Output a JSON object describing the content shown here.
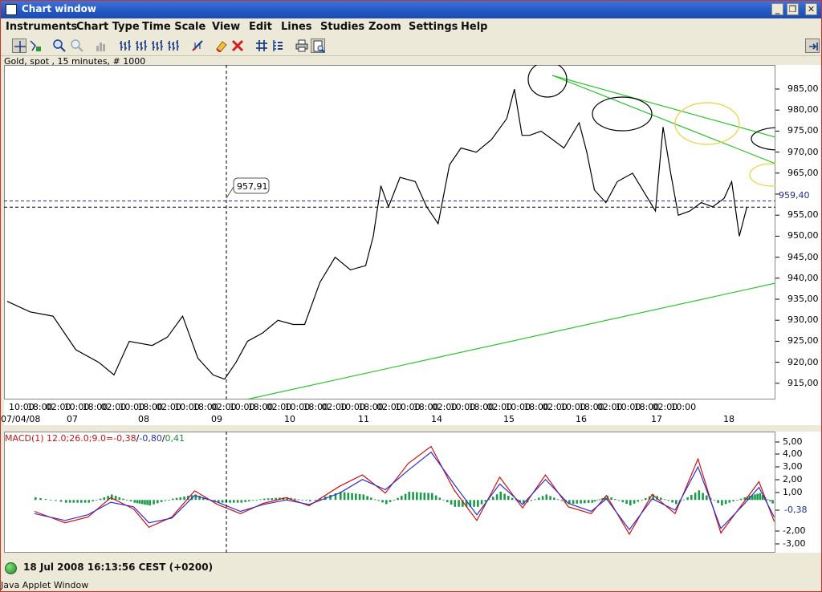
{
  "window": {
    "title": "Chart window",
    "buttons": [
      "minimize",
      "restore",
      "close"
    ]
  },
  "menu": [
    "Instruments",
    "Chart Type",
    "Time Scale",
    "View",
    "Edit",
    "Lines",
    "Studies",
    "Zoom",
    "Settings",
    "Help"
  ],
  "toolbar_icons": [
    "crosshair-icon",
    "data-icon",
    "zoom-in-icon",
    "zoom-out-icon",
    "bar-chart-icon",
    "candles-1-icon",
    "candles-2-icon",
    "candles-3-icon",
    "candles-4-icon",
    "line-tool-icon",
    "eraser-icon",
    "delete-lines-icon",
    "grid-icon",
    "settings-icon",
    "print-icon",
    "print-preview-icon",
    "dock-icon"
  ],
  "chart": {
    "header": "Gold, spot , 15 minutes, # 1000",
    "crosshair_label": "957,91",
    "current_price_label": "959,40",
    "price_axis_labels": [
      "985,00",
      "980,00",
      "975,00",
      "970,00",
      "965,00",
      "960,00",
      "955,00",
      "950,00",
      "945,00",
      "940,00",
      "935,00",
      "930,00",
      "925,00",
      "920,00",
      "915,00"
    ],
    "time_axis_times": [
      "10:00",
      "18:00",
      "02:00",
      "10:00",
      "18:00",
      "02:00",
      "10:00",
      "18:00",
      "02:00",
      "10:00",
      "18:00",
      "02:00",
      "10:00",
      "18:00",
      "02:00",
      "10:00",
      "18:00",
      "02:00",
      "10:00",
      "18:00",
      "02:00",
      "10:00",
      "18:00",
      "02:00",
      "10:00",
      "18:00",
      "02:00",
      "10:00",
      "18:00",
      "02:00",
      "10:00",
      "18:00",
      "02:00",
      "10:00",
      "18:00",
      "02:00",
      "10:00"
    ],
    "time_axis_dates": [
      "07/04/08",
      "07",
      "08",
      "09",
      "10",
      "11",
      "14",
      "15",
      "16",
      "17",
      "18"
    ]
  },
  "macd": {
    "header_prefix": "MACD(1) 12.0;26.0;9.0=",
    "header_v1": "-0,38",
    "header_sep1": "/",
    "header_v2": "-0,80",
    "header_sep2": "/",
    "header_v3": "0,41",
    "axis_labels": [
      "5,00",
      "4,00",
      "3,00",
      "2,00",
      "1,00",
      "-0,38",
      "-2,00",
      "-3,00"
    ]
  },
  "status": {
    "datetime": "18 Jul 2008 16:13:56  CEST (+0200)",
    "applet": "Java Applet Window"
  },
  "chart_data": {
    "type": "line",
    "title": "Gold, spot , 15 minutes, # 1000",
    "xlabel": "",
    "ylabel": "",
    "ylim": [
      910,
      990
    ],
    "x": [
      "07/04/08 10:00",
      "07 10:00",
      "08 10:00",
      "09 10:00",
      "10 10:00",
      "11 10:00",
      "14 10:00",
      "15 10:00",
      "16 10:00",
      "17 10:00",
      "18 10:00"
    ],
    "series": [
      {
        "values": [
          935.5,
          925,
          928,
          920,
          930,
          944,
          962,
          975,
          976,
          965,
          957
        ],
        "points": [
          [
            0,
            935.5
          ],
          [
            6,
            933
          ],
          [
            12,
            932
          ],
          [
            18,
            924
          ],
          [
            24,
            921
          ],
          [
            28,
            918
          ],
          [
            32,
            926
          ],
          [
            38,
            925
          ],
          [
            42,
            927
          ],
          [
            46,
            932
          ],
          [
            50,
            922
          ],
          [
            54,
            918
          ],
          [
            57,
            917
          ],
          [
            60,
            921
          ],
          [
            63,
            926
          ],
          [
            67,
            928
          ],
          [
            71,
            931
          ],
          [
            75,
            930
          ],
          [
            78,
            930
          ],
          [
            82,
            940
          ],
          [
            86,
            946
          ],
          [
            90,
            943
          ],
          [
            94,
            944
          ],
          [
            96,
            951
          ],
          [
            98,
            963
          ],
          [
            100,
            958
          ],
          [
            103,
            965
          ],
          [
            107,
            964
          ],
          [
            110,
            958
          ],
          [
            113,
            954
          ],
          [
            116,
            968
          ],
          [
            119,
            972
          ],
          [
            123,
            971
          ],
          [
            127,
            974
          ],
          [
            131,
            979
          ],
          [
            133,
            986
          ],
          [
            135,
            975
          ],
          [
            137,
            975
          ],
          [
            140,
            976
          ],
          [
            143,
            974
          ],
          [
            146,
            972
          ],
          [
            150,
            978
          ],
          [
            152,
            971
          ],
          [
            154,
            962
          ],
          [
            157,
            959
          ],
          [
            160,
            964
          ],
          [
            164,
            966
          ],
          [
            168,
            960
          ],
          [
            170,
            957
          ],
          [
            172,
            977
          ],
          [
            174,
            966
          ],
          [
            176,
            956
          ],
          [
            179,
            957
          ],
          [
            182,
            959
          ],
          [
            185,
            958
          ],
          [
            188,
            960
          ],
          [
            190,
            964
          ],
          [
            192,
            951
          ],
          [
            194,
            958
          ]
        ]
      }
    ],
    "crosshair": {
      "price": 957.91,
      "x": "09 02:00"
    },
    "current_price": 959.4,
    "macd": {
      "ylim": [
        -3.5,
        5.5
      ],
      "zero_label": -0.38,
      "macd_line": [
        [
          0,
          -1.0
        ],
        [
          8,
          -2.0
        ],
        [
          14,
          -1.5
        ],
        [
          20,
          0.2
        ],
        [
          26,
          -0.8
        ],
        [
          30,
          -2.4
        ],
        [
          36,
          -1.5
        ],
        [
          42,
          0.8
        ],
        [
          48,
          -0.4
        ],
        [
          54,
          -1.2
        ],
        [
          60,
          -0.3
        ],
        [
          66,
          0.2
        ],
        [
          72,
          -0.5
        ],
        [
          80,
          1.2
        ],
        [
          86,
          2.2
        ],
        [
          92,
          0.6
        ],
        [
          98,
          3.2
        ],
        [
          104,
          4.7
        ],
        [
          110,
          0.9
        ],
        [
          116,
          -1.8
        ],
        [
          122,
          2.0
        ],
        [
          128,
          -0.7
        ],
        [
          134,
          2.2
        ],
        [
          140,
          -0.6
        ],
        [
          146,
          -1.2
        ],
        [
          150,
          0.4
        ],
        [
          156,
          -3.0
        ],
        [
          162,
          0.5
        ],
        [
          168,
          -1.2
        ],
        [
          174,
          3.6
        ],
        [
          180,
          -2.9
        ],
        [
          186,
          -0.2
        ],
        [
          190,
          1.6
        ],
        [
          194,
          -1.9
        ]
      ],
      "signal_line": [
        [
          0,
          -1.2
        ],
        [
          8,
          -1.8
        ],
        [
          14,
          -1.3
        ],
        [
          20,
          -0.2
        ],
        [
          26,
          -0.6
        ],
        [
          30,
          -2.0
        ],
        [
          36,
          -1.6
        ],
        [
          42,
          0.4
        ],
        [
          48,
          -0.2
        ],
        [
          54,
          -1.0
        ],
        [
          60,
          -0.4
        ],
        [
          66,
          0.0
        ],
        [
          72,
          -0.4
        ],
        [
          80,
          0.6
        ],
        [
          86,
          1.8
        ],
        [
          92,
          0.9
        ],
        [
          98,
          2.6
        ],
        [
          104,
          4.2
        ],
        [
          110,
          1.4
        ],
        [
          116,
          -1.3
        ],
        [
          122,
          1.4
        ],
        [
          128,
          -0.4
        ],
        [
          134,
          1.8
        ],
        [
          140,
          -0.3
        ],
        [
          146,
          -1.0
        ],
        [
          150,
          0.1
        ],
        [
          156,
          -2.6
        ],
        [
          162,
          0.1
        ],
        [
          168,
          -0.9
        ],
        [
          174,
          2.9
        ],
        [
          180,
          -2.5
        ],
        [
          186,
          -0.4
        ],
        [
          190,
          1.1
        ],
        [
          194,
          -1.5
        ]
      ]
    }
  }
}
